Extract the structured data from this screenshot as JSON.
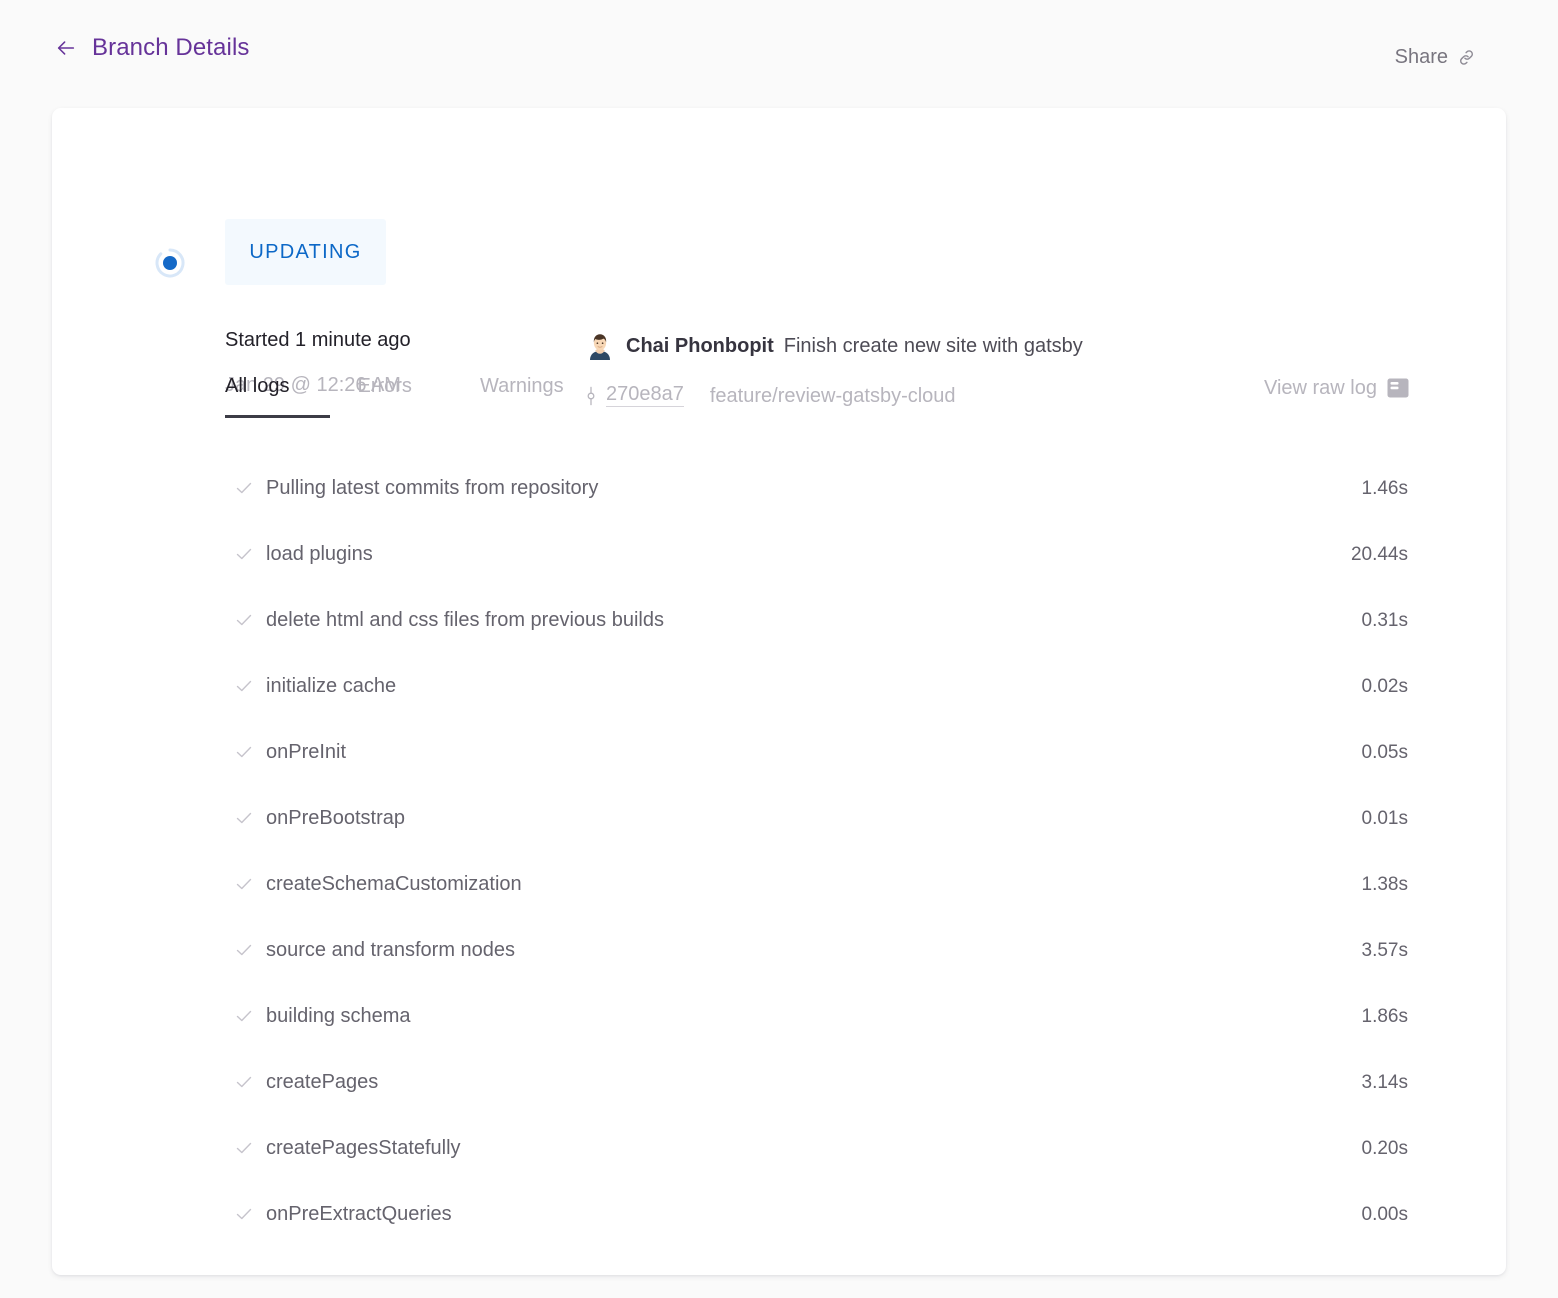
{
  "header": {
    "back_icon": "arrow-left-icon",
    "title": "Branch Details",
    "share_label": "Share",
    "share_icon": "link-icon",
    "accent_color": "#663399"
  },
  "build": {
    "status_icon": "spinner-icon",
    "status_label": "UPDATING",
    "status_color": "#0c68c7",
    "status_background": "#f3f9fe",
    "started_text": "Started 1 minute ago",
    "started_timestamp": "Jan 29 @ 12:26 AM",
    "avatar_icon": "user-avatar",
    "author": "Chai Phonbopit",
    "commit_message": "Finish create new site with gatsby",
    "commit_icon": "git-commit-icon",
    "commit_hash": "270e8a7",
    "branch": "feature/review-gatsby-cloud"
  },
  "tabs": [
    {
      "label": "All logs",
      "active": true
    },
    {
      "label": "Errors",
      "active": false
    },
    {
      "label": "Warnings",
      "active": false
    }
  ],
  "raw_log": {
    "label": "View raw log",
    "icon": "window-panel-icon"
  },
  "logs": [
    {
      "status_icon": "check-icon",
      "label": "Pulling latest commits from repository",
      "duration": "1.46s"
    },
    {
      "status_icon": "check-icon",
      "label": "load plugins",
      "duration": "20.44s"
    },
    {
      "status_icon": "check-icon",
      "label": "delete html and css files from previous builds",
      "duration": "0.31s"
    },
    {
      "status_icon": "check-icon",
      "label": "initialize cache",
      "duration": "0.02s"
    },
    {
      "status_icon": "check-icon",
      "label": "onPreInit",
      "duration": "0.05s"
    },
    {
      "status_icon": "check-icon",
      "label": "onPreBootstrap",
      "duration": "0.01s"
    },
    {
      "status_icon": "check-icon",
      "label": "createSchemaCustomization",
      "duration": "1.38s"
    },
    {
      "status_icon": "check-icon",
      "label": "source and transform nodes",
      "duration": "3.57s"
    },
    {
      "status_icon": "check-icon",
      "label": "building schema",
      "duration": "1.86s"
    },
    {
      "status_icon": "check-icon",
      "label": "createPages",
      "duration": "3.14s"
    },
    {
      "status_icon": "check-icon",
      "label": "createPagesStatefully",
      "duration": "0.20s"
    },
    {
      "status_icon": "check-icon",
      "label": "onPreExtractQueries",
      "duration": "0.00s"
    }
  ]
}
